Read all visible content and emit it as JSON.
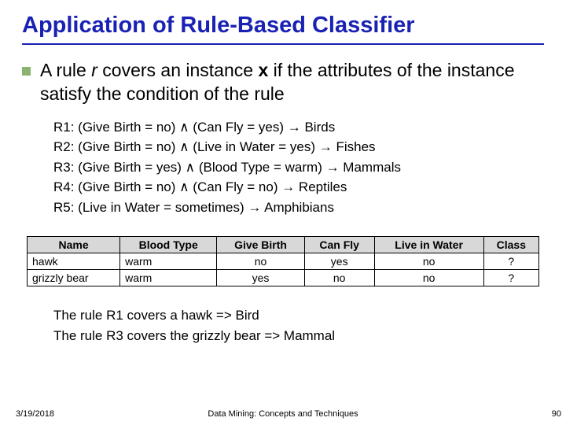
{
  "title": "Application of Rule-Based Classifier",
  "lead": {
    "pre": "A rule ",
    "r": "r",
    "mid": " covers an instance ",
    "x": "x",
    "post": " if the attributes of the instance satisfy the condition of the rule"
  },
  "rules": [
    "R1: (Give Birth = no) ∧ (Can Fly = yes) → Birds",
    "R2: (Give Birth = no) ∧ (Live in Water = yes) → Fishes",
    "R3: (Give Birth = yes) ∧ (Blood Type = warm) → Mammals",
    "R4: (Give Birth = no) ∧ (Can Fly = no) → Reptiles",
    "R5: (Live in Water = sometimes) → Amphibians"
  ],
  "table": {
    "headers": [
      "Name",
      "Blood Type",
      "Give Birth",
      "Can Fly",
      "Live in Water",
      "Class"
    ],
    "rows": [
      [
        "hawk",
        "warm",
        "no",
        "yes",
        "no",
        "?"
      ],
      [
        "grizzly bear",
        "warm",
        "yes",
        "no",
        "no",
        "?"
      ]
    ]
  },
  "conclusions": [
    "The rule R1 covers a hawk => Bird",
    "The rule R3 covers the grizzly bear => Mammal"
  ],
  "footer": {
    "date": "3/19/2018",
    "source": "Data Mining: Concepts and Techniques",
    "page": "90"
  }
}
